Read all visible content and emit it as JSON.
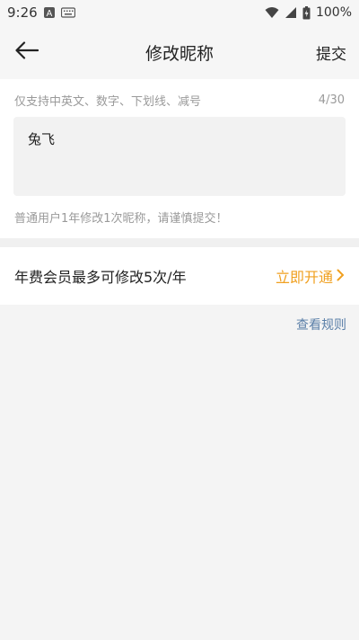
{
  "status_bar": {
    "time": "9:26",
    "battery": "100%",
    "icons": [
      "notification-a-icon",
      "keyboard-icon",
      "wifi-icon",
      "signal-icon",
      "battery-icon"
    ]
  },
  "nav": {
    "title": "修改昵称",
    "submit_label": "提交",
    "back_icon": "back-arrow-icon"
  },
  "form": {
    "hint": "仅支持中英文、数字、下划线、减号",
    "counter": "4/30",
    "nickname_value": "兔飞",
    "warning": "普通用户1年修改1次昵称，请谨慎提交！"
  },
  "vip": {
    "text": "年费会员最多可修改5次/年",
    "action_label": "立即开通",
    "action_color": "#f0a020"
  },
  "rules_link": "查看规则",
  "colors": {
    "background": "#f4f4f4",
    "link": "#5a7fa8",
    "accent": "#f0a020"
  }
}
